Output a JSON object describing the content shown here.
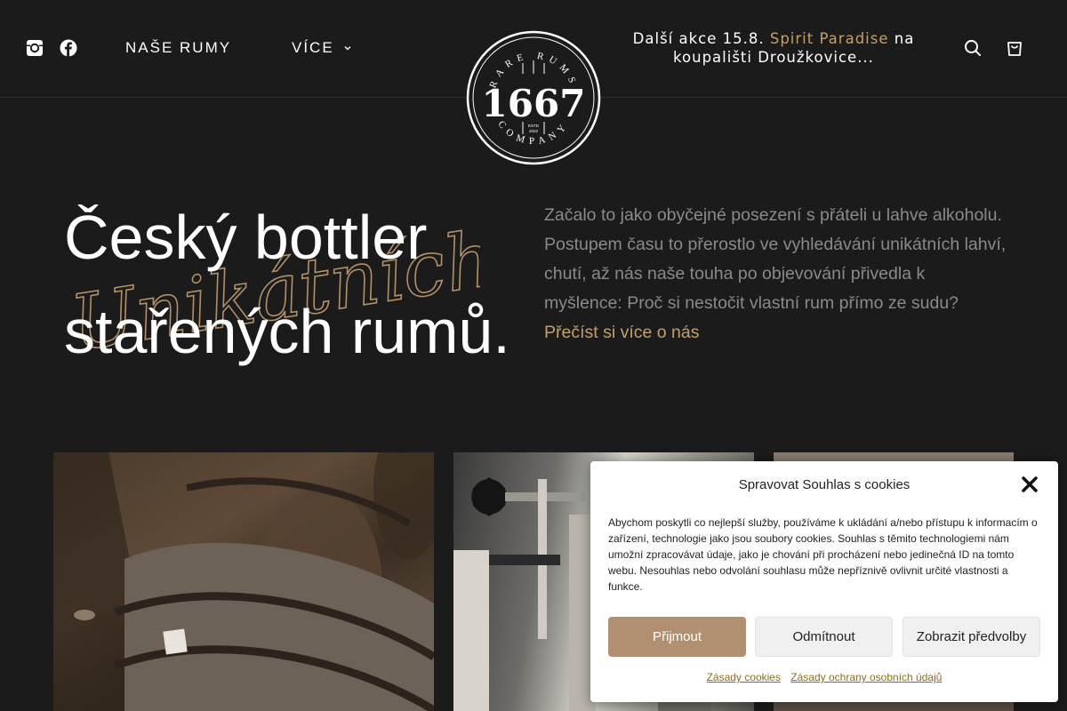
{
  "header": {
    "social": [
      {
        "icon": "instagram-icon"
      },
      {
        "icon": "facebook-icon"
      }
    ],
    "nav": {
      "rumy_label": "NAŠE RUMY",
      "more_label": "VÍCE"
    },
    "announcement": {
      "before": "Další akce 15.8. ",
      "accent": "Spirit Paradise",
      "after": " na koupališti Droužkovice..."
    },
    "icons": {
      "search": "search-icon",
      "cart": "shopping-bag-icon"
    }
  },
  "logo": {
    "number": "1667",
    "top_text": "RARE RUMS",
    "bottom_text": "COMPANY",
    "estd": "ESTD",
    "year": "2022"
  },
  "hero": {
    "title_line1": "Český bottler",
    "title_line2": "stařených rumů.",
    "script_word": "Unikátních",
    "paragraph": "Začalo to jako obyčejné posezení s přáteli u lahve alkoholu. Postupem času to přerostlo ve vyhledávání unikátních lahví, chutí, až nás naše touha po objevování přivedla k myšlence: Proč si nestočit vlastní rum přímo ze sudu? ",
    "link": "Přečíst si více o nás"
  },
  "cookie": {
    "title": "Spravovat Souhlas s cookies",
    "text": "Abychom poskytli co nejlepší služby, používáme k ukládání a/nebo přístupu k informacím o zařízení, technologie jako jsou soubory cookies. Souhlas s těmito technologiemi nám umožní zpracovávat údaje, jako je chování při procházení nebo jedinečná ID na tomto webu. Nesouhlas nebo odvolání souhlasu může nepříznivě ovlivnit určité vlastnosti a funkce.",
    "accept_label": "Přijmout",
    "deny_label": "Odmítnout",
    "prefs_label": "Zobrazit předvolby",
    "link_cookies": "Zásady cookies",
    "link_privacy": "Zásady ochrany osobních údajů"
  },
  "colors": {
    "accent": "#c3a06a",
    "background": "#1b1b1b",
    "button_accept": "#b09070"
  }
}
